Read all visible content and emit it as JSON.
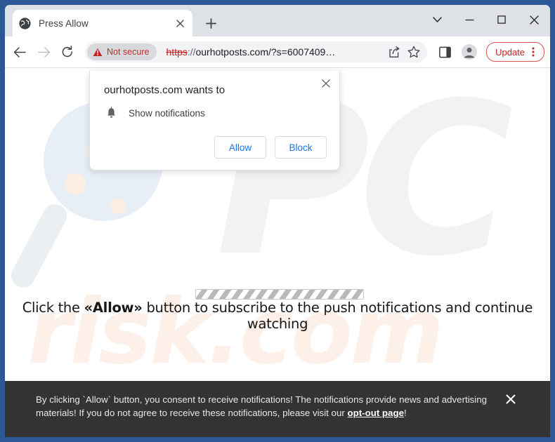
{
  "window": {
    "controls": {
      "tab_search": "tab-search-chevron",
      "minimize": "minimize",
      "maximize": "maximize",
      "close": "close"
    }
  },
  "tab_strip": {
    "active_tab": {
      "title": "Press Allow",
      "favicon": "globe-icon",
      "close": "x"
    },
    "new_tab": "+"
  },
  "toolbar": {
    "back": "back-arrow",
    "forward": "forward-arrow",
    "reload": "reload-arrow",
    "omnibox": {
      "security_label": "Not secure",
      "security_icon": "warning-triangle",
      "url_scheme": "https",
      "url_separator": "://",
      "url_rest": "ourhotposts.com/?s=6007409…",
      "share_icon": "share-icon",
      "bookmark_icon": "star-icon"
    },
    "side_panel_icon": "side-panel-icon",
    "profile_icon": "profile-avatar-icon",
    "update_label": "Update",
    "update_menu_icon": "three-dot-menu"
  },
  "permission_dialog": {
    "title": "ourhotposts.com wants to",
    "option_icon": "bell-icon",
    "option_label": "Show notifications",
    "allow_label": "Allow",
    "block_label": "Block",
    "close_label": "×"
  },
  "page": {
    "headline_prefix": "Click the ",
    "headline_emphasis": "«Allow»",
    "headline_suffix": " button to subscribe to the push notifications and continue watching",
    "watermark_logo": "PC",
    "watermark_text": "risk.com",
    "progress_bar": "loading-progress"
  },
  "consent_banner": {
    "text_part1": "By clicking `Allow` button, you consent to receive notifications! The notifications provide news and advertising materials! If you do not agree to receive these notifications, please visit our ",
    "link_label": "opt-out page",
    "text_part2": "!",
    "close_label": "✕"
  },
  "colors": {
    "window_frame": "#2c5898",
    "tab_strip": "#dee1e6",
    "not_secure_red": "#bc2f2f",
    "update_red": "#c5221f",
    "link_blue": "#1a73e8",
    "banner_dark": "#333333",
    "watermark_blue": "#e8eef6",
    "watermark_peach": "#fdf0e8"
  }
}
